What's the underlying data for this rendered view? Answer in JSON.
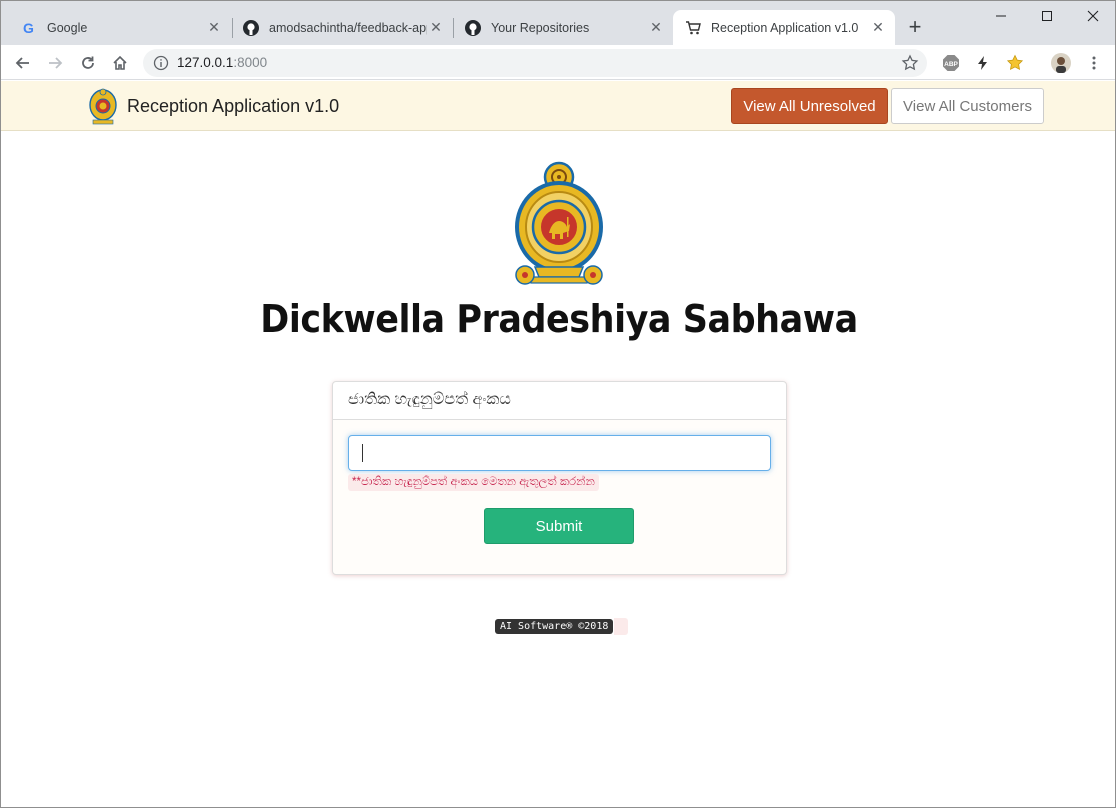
{
  "browser": {
    "tabs": [
      {
        "title": "Google",
        "icon": "google-icon"
      },
      {
        "title": "amodsachintha/feedback-app",
        "icon": "github-icon"
      },
      {
        "title": "Your Repositories",
        "icon": "github-icon"
      },
      {
        "title": "Reception Application v1.0",
        "icon": "cart-icon",
        "active": true
      }
    ],
    "url_host": "127.0.0.1",
    "url_port": ":8000"
  },
  "app": {
    "title": "Reception Application v1.0",
    "unresolved_button": "View All Unresolved",
    "customers_button": "View All Customers"
  },
  "main": {
    "organization": "Dickwella Pradeshiya Sabhawa",
    "panel_heading": "ජාතික හැඳුනුම්පත් අංකය",
    "nic_input_value": "",
    "hint": "**ජාතික හැඳුනුම්පත් අංකය මෙතන ඇතුලත් කරන්න",
    "submit_label": "Submit"
  },
  "footer": {
    "copyright": "AI Software® ©2018"
  },
  "colors": {
    "appbar_bg": "#fdf7e3",
    "unresolved_btn": "#c4582d",
    "submit_btn": "#26b37c",
    "hint_text": "#c7254e"
  }
}
